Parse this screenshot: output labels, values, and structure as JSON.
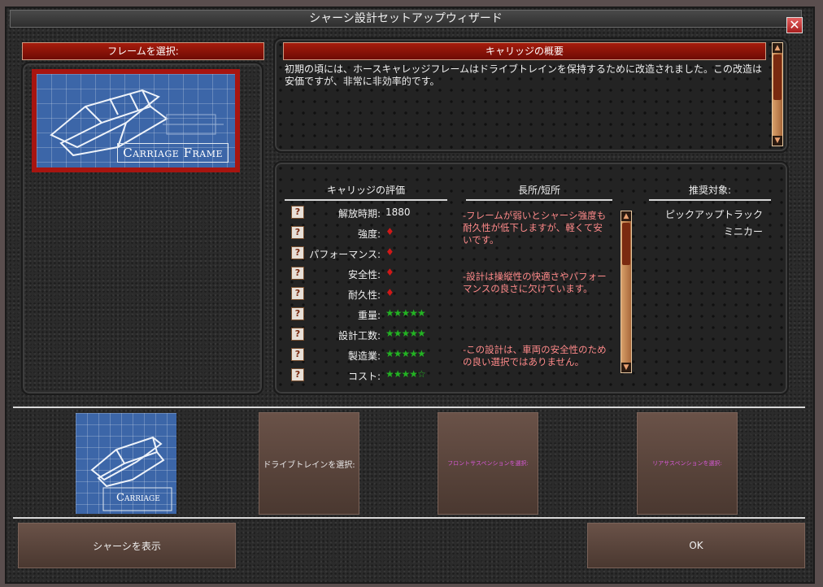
{
  "window": {
    "title": "シャーシ設計セットアップウィザード"
  },
  "icons": {
    "close": "close-icon",
    "up": "arrow-up-icon",
    "help": "question-icon",
    "red_pin": "red-pin-icon",
    "green_star": "green-star-icon"
  },
  "colors": {
    "accent_red": "#a61c0c",
    "pros_text": "#ff8a8a",
    "star_green": "#23b323",
    "disabled_text": "#d858d8"
  },
  "frame_select": {
    "label": "フレームを選択:",
    "card_label": "Carriage Frame"
  },
  "overview": {
    "title": "キャリッジの概要",
    "text": "初期の頃には、ホースキャレッジフレームはドライブトレインを保持するために改造されました。この改造は安価ですが、非常に非効率的です。"
  },
  "evaluation": {
    "heading": "キャリッジの評価",
    "rows": [
      {
        "label": "解放時期:",
        "value": "1880",
        "type": "text"
      },
      {
        "label": "強度:",
        "rating": 1,
        "type": "pin"
      },
      {
        "label": "パフォーマンス:",
        "rating": 1,
        "type": "pin"
      },
      {
        "label": "安全性:",
        "rating": 1,
        "type": "pin"
      },
      {
        "label": "耐久性:",
        "rating": 1,
        "type": "pin"
      },
      {
        "label": "重量:",
        "rating": 5,
        "type": "stars"
      },
      {
        "label": "設計工数:",
        "rating": 5,
        "type": "stars"
      },
      {
        "label": "製造業:",
        "rating": 5,
        "type": "stars"
      },
      {
        "label": "コスト:",
        "rating": 4.5,
        "type": "stars"
      }
    ]
  },
  "pros_cons": {
    "heading": "長所/短所",
    "items": [
      "-フレームが弱いとシャーシ強度も耐久性が低下しますが、軽くて安いです。",
      "-設計は操縦性の快適さやパフォーマンスの良さに欠けています。",
      "-この設計は、車両の安全性のための良い選択ではありません。"
    ]
  },
  "recommended": {
    "heading": "推奨対象:",
    "items": [
      "ピックアップトラック",
      "ミニカー"
    ]
  },
  "steps": {
    "thumb_label": "Carriage",
    "drivetrain": "ドライブトレインを選択:",
    "front_suspension": "フロントサスペンションを選択:",
    "rear_suspension": "リアサスペンションを選択:"
  },
  "buttons": {
    "show_chassis": "シャーシを表示",
    "ok": "OK"
  }
}
